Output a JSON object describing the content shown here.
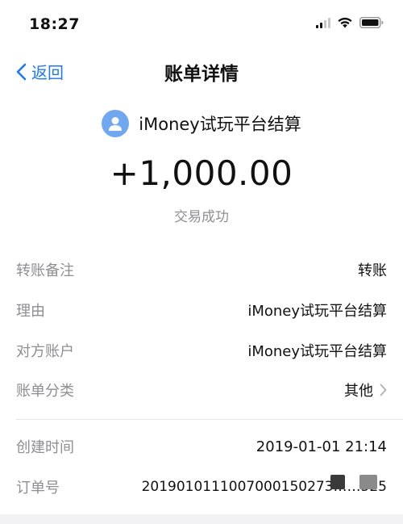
{
  "status_bar": {
    "time": "18:27",
    "icons": [
      "signal-icon",
      "wifi-icon",
      "battery-icon"
    ]
  },
  "nav": {
    "back_label": "返回",
    "title": "账单详情"
  },
  "header": {
    "avatar_icon": "person-icon",
    "counterparty": "iMoney试玩平台结算",
    "amount": "+1,000.00",
    "status": "交易成功"
  },
  "details": [
    {
      "label": "转账备注",
      "value": "转账"
    },
    {
      "label": "理由",
      "value": "iMoney试玩平台结算"
    },
    {
      "label": "对方账户",
      "value": "iMoney试玩平台结算"
    },
    {
      "label": "账单分类",
      "value": "其他"
    }
  ],
  "meta": [
    {
      "label": "创建时间",
      "value": "2019-01-01 21:14"
    },
    {
      "label": "订单号",
      "value": "2019010111007000150273……525"
    }
  ],
  "colors": {
    "accent": "#1f7aec",
    "avatar": "#6fa8f0",
    "label_gray": "#8e8e93"
  }
}
